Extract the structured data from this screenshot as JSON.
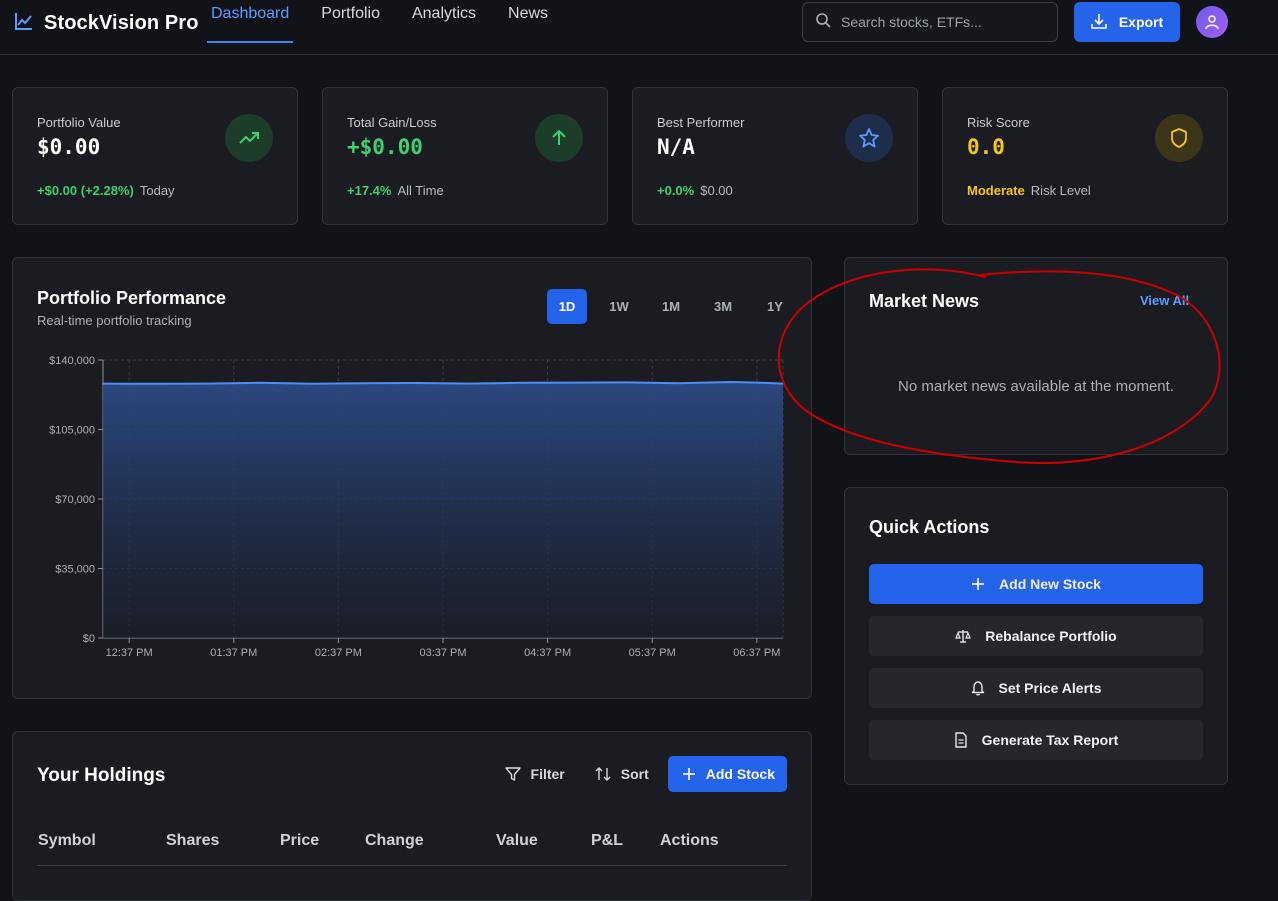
{
  "app": {
    "name": "StockVision Pro"
  },
  "nav": {
    "items": [
      {
        "label": "Dashboard",
        "active": true
      },
      {
        "label": "Portfolio",
        "active": false
      },
      {
        "label": "Analytics",
        "active": false
      },
      {
        "label": "News",
        "active": false
      }
    ]
  },
  "search": {
    "placeholder": "Search stocks, ETFs...",
    "value": ""
  },
  "export_label": "Export",
  "stats": [
    {
      "label": "Portfolio Value",
      "value": "$0.00",
      "highlight": "+$0.00 (+2.28%)",
      "sub": "Today",
      "icon": "trending-up-icon"
    },
    {
      "label": "Total Gain/Loss",
      "value": "+$0.00",
      "highlight": "+17.4%",
      "sub": "All Time",
      "icon": "arrow-up-icon"
    },
    {
      "label": "Best Performer",
      "value": "N/A",
      "highlight": "+0.0%",
      "sub": "$0.00",
      "icon": "star-icon"
    },
    {
      "label": "Risk Score",
      "value": "0.0",
      "highlight": "Moderate",
      "sub": "Risk Level",
      "icon": "shield-icon"
    }
  ],
  "performance": {
    "title": "Portfolio Performance",
    "subtitle": "Real-time portfolio tracking",
    "ranges": [
      "1D",
      "1W",
      "1M",
      "3M",
      "1Y"
    ],
    "active_range": "1D"
  },
  "chart_data": {
    "type": "area",
    "title": "",
    "xlabel": "",
    "ylabel": "",
    "x_ticks": [
      "12:37 PM",
      "01:37 PM",
      "02:37 PM",
      "03:37 PM",
      "04:37 PM",
      "05:37 PM",
      "06:37 PM"
    ],
    "y_ticks": [
      "$0",
      "$35,000",
      "$70,000",
      "$105,000",
      "$140,000"
    ],
    "ylim": [
      0,
      140000
    ],
    "xlim": [
      0,
      6.5
    ],
    "grid": true,
    "series": [
      {
        "x": [
          -0.25,
          0,
          0.5,
          1,
          1.5,
          2,
          2.5,
          3,
          3.5,
          4,
          4.5,
          5,
          5.5,
          6,
          6.25,
          6.5
        ],
        "values": [
          128200,
          128100,
          128000,
          128100,
          128500,
          128000,
          128300,
          128400,
          128100,
          128500,
          128600,
          128700,
          128300,
          128900,
          128600,
          128100
        ]
      }
    ]
  },
  "news": {
    "title": "Market News",
    "view_all": "View All",
    "empty_message": "No market news available at the moment."
  },
  "quick_actions": {
    "title": "Quick Actions",
    "items": [
      {
        "label": "Add New Stock",
        "icon": "plus-icon"
      },
      {
        "label": "Rebalance Portfolio",
        "icon": "scale-icon"
      },
      {
        "label": "Set Price Alerts",
        "icon": "bell-icon"
      },
      {
        "label": "Generate Tax Report",
        "icon": "document-icon"
      }
    ]
  },
  "holdings": {
    "title": "Your Holdings",
    "filter_label": "Filter",
    "sort_label": "Sort",
    "add_label": "Add Stock",
    "columns": [
      "Symbol",
      "Shares",
      "Price",
      "Change",
      "Value",
      "P&L",
      "Actions"
    ]
  },
  "colors": {
    "accent": "#2563eb",
    "positive": "#3ecf6e",
    "warning": "#f5c518",
    "annotation": "#cc0000"
  }
}
